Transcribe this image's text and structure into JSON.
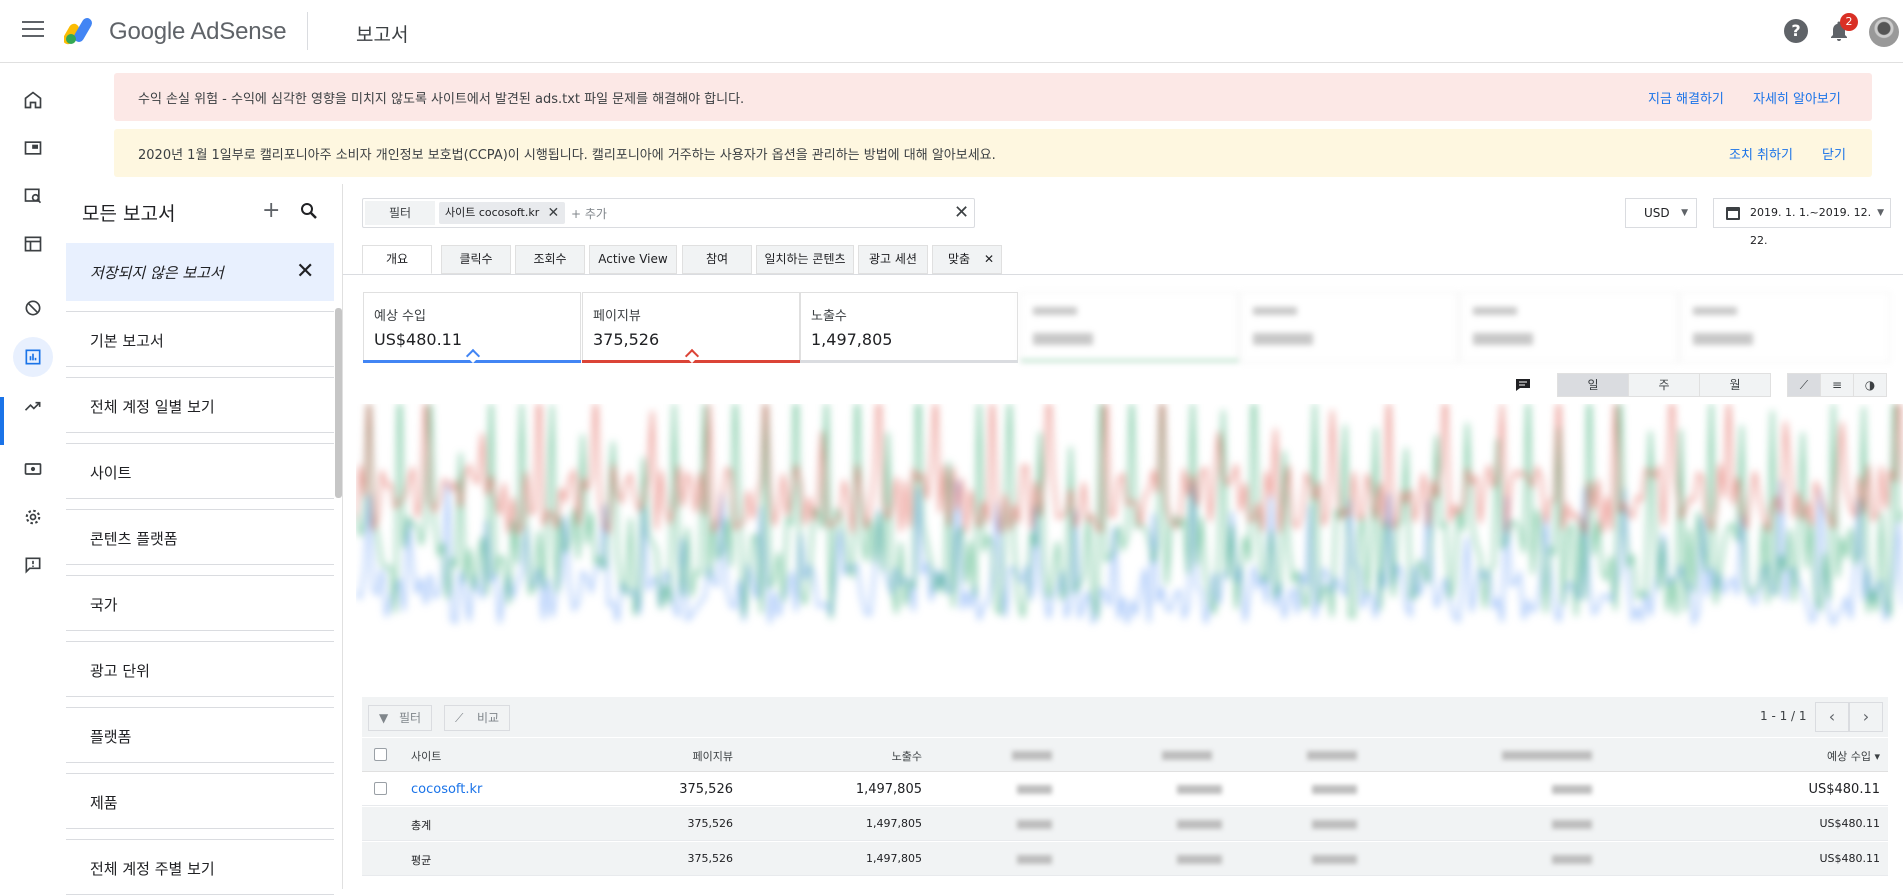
{
  "app": {
    "brand": "Google AdSense",
    "page_title": "보고서",
    "notification_count": "2",
    "icons": [
      "menu-icon",
      "adsense-logo",
      "help-icon",
      "bell-icon",
      "avatar"
    ]
  },
  "rail": [
    "home-icon",
    "ads-icon",
    "site-review-icon",
    "layout-icon",
    "block-icon",
    "reports-icon",
    "trending-icon",
    "payments-icon",
    "settings-icon",
    "feedback-icon"
  ],
  "banners": {
    "risk": {
      "text": "수익 손실 위험 - 수익에 심각한 영향을 미치지 않도록 사이트에서 발견된 ads.txt 파일 문제를 해결해야 합니다.",
      "action_fix": "지금 해결하기",
      "action_learn": "자세히 알아보기"
    },
    "ccpa": {
      "text": "2020년 1월 1일부로 캘리포니아주 소비자 개인정보 보호법(CCPA)이 시행됩니다. 캘리포니아에 거주하는 사용자가 옵션을 관리하는 방법에 대해 알아보세요.",
      "action_take": "조치 취하기",
      "action_close": "닫기"
    }
  },
  "reports_panel": {
    "title": "모든 보고서",
    "unsaved": "저장되지 않은 보고서",
    "items": [
      "기본 보고서",
      "전체 계정 일별 보기",
      "사이트",
      "콘텐츠 플랫폼",
      "국가",
      "광고 단위",
      "플랫폼",
      "제품",
      "전체 계정 주별 보기"
    ]
  },
  "filter": {
    "button": "필터",
    "chip": "사이트 cocosoft.kr",
    "add_placeholder": "+ 추가"
  },
  "currency": "USD",
  "date_range": "2019. 1. 1.~2019. 12. 22.",
  "tabs": [
    "개요",
    "클릭수",
    "조회수",
    "Active View",
    "참여",
    "일치하는 콘텐츠",
    "광고 세션",
    "맞춤"
  ],
  "kpis": [
    {
      "label": "예상 수입",
      "value": "US$480.11",
      "color": "#4285f4"
    },
    {
      "label": "페이지뷰",
      "value": "375,526",
      "color": "#db4437"
    },
    {
      "label": "노출수",
      "value": "1,497,805",
      "color": "#dadce0"
    }
  ],
  "granularity": [
    "일",
    "주",
    "월"
  ],
  "table": {
    "toolbar_filter": "필터",
    "toolbar_compare": "비교",
    "pager": "1 - 1 / 1",
    "headers": {
      "site": "사이트",
      "pageviews": "페이지뷰",
      "impressions": "노출수",
      "earnings": "예상 수입 ▾"
    },
    "row": {
      "site": "cocosoft.kr",
      "pageviews": "375,526",
      "impressions": "1,497,805",
      "earnings": "US$480.11"
    },
    "total": {
      "label": "총계",
      "pageviews": "375,526",
      "impressions": "1,497,805",
      "earnings": "US$480.11"
    },
    "average": {
      "label": "평균",
      "pageviews": "375,526",
      "impressions": "1,497,805",
      "earnings": "US$480.11"
    }
  },
  "colors": {
    "accent": "#1a73e8",
    "pageviews_line": "#db4437",
    "earnings_line": "#4285f4",
    "clicks_line": "#0f9d58"
  }
}
